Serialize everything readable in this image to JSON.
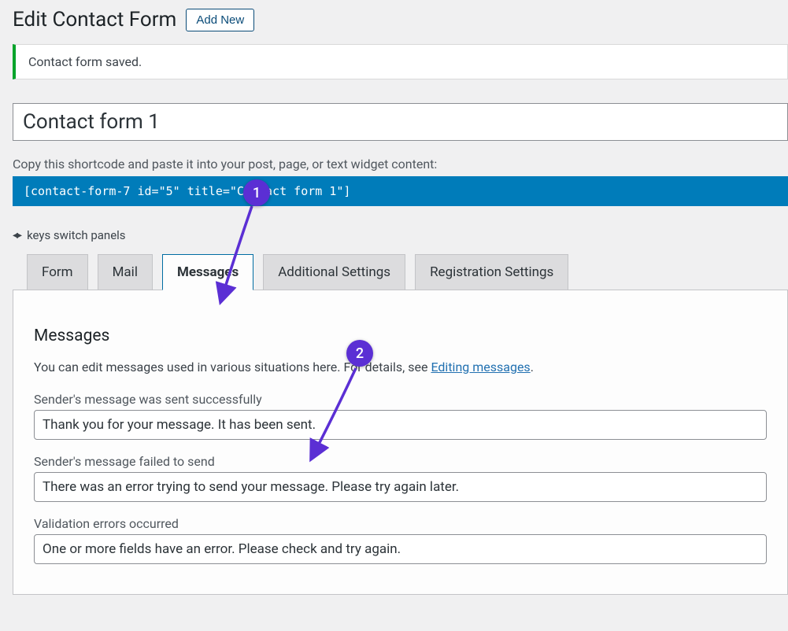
{
  "header": {
    "title": "Edit Contact Form",
    "add_new": "Add New"
  },
  "notice": {
    "text": "Contact form saved."
  },
  "form_title": "Contact form 1",
  "shortcode": {
    "hint": "Copy this shortcode and paste it into your post, page, or text widget content:",
    "code": "[contact-form-7 id=\"5\" title=\"Contact form 1\"]"
  },
  "keys_switch": "keys switch panels",
  "tabs": {
    "form": "Form",
    "mail": "Mail",
    "messages": "Messages",
    "additional": "Additional Settings",
    "registration": "Registration Settings"
  },
  "messages_panel": {
    "heading": "Messages",
    "desc_pre": "You can edit messages used in various situations here. For details, see ",
    "desc_link": "Editing messages",
    "desc_post": ".",
    "fields": [
      {
        "label": "Sender's message was sent successfully",
        "value": "Thank you for your message. It has been sent."
      },
      {
        "label": "Sender's message failed to send",
        "value": "There was an error trying to send your message. Please try again later."
      },
      {
        "label": "Validation errors occurred",
        "value": "One or more fields have an error. Please check and try again."
      }
    ]
  },
  "annotations": {
    "one": "1",
    "two": "2"
  }
}
